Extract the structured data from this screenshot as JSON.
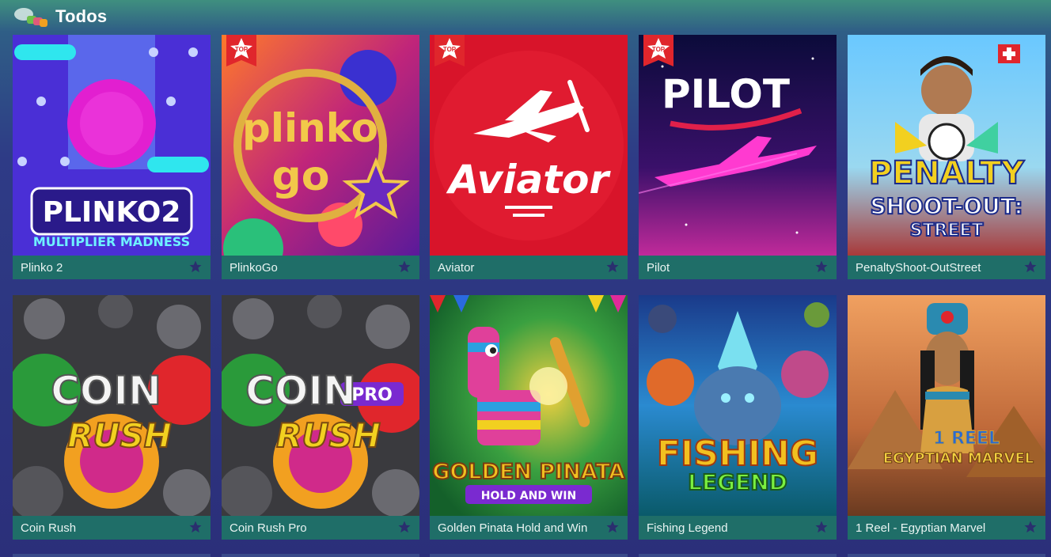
{
  "header": {
    "title": "Todos",
    "logo_icon": "categories-icon"
  },
  "badge_text": "TOP",
  "games": [
    {
      "name": "Plinko 2",
      "art_title": "PLINKO2",
      "art_subtitle": "MULTIPLIER MADNESS",
      "top": false
    },
    {
      "name": "PlinkoGo",
      "art_title": "plinko",
      "art_subtitle": "go",
      "top": true
    },
    {
      "name": "Aviator",
      "art_title": "Aviator",
      "top": true
    },
    {
      "name": "Pilot",
      "art_title": "PILOT",
      "top": true
    },
    {
      "name": "PenaltyShoot-OutStreet",
      "art_title": "PENALTY",
      "art_subtitle": "SHOOT-OUT:",
      "art_subtitle2": "STREET",
      "top": false
    },
    {
      "name": "Coin Rush",
      "art_title": "COIN",
      "art_subtitle": "RUSH",
      "top": false
    },
    {
      "name": "Coin Rush Pro",
      "art_title": "COIN",
      "art_subtitle": "RUSH",
      "art_badge": "PRO",
      "top": false
    },
    {
      "name": "Golden Pinata Hold and Win",
      "art_title": "GOLDEN PINATA",
      "art_subtitle": "HOLD AND WIN",
      "top": false
    },
    {
      "name": "Fishing Legend",
      "art_title": "FISHING",
      "art_subtitle": "LEGEND",
      "top": false
    },
    {
      "name": "1 Reel - Egyptian Marvel",
      "art_title": "1 REEL",
      "art_subtitle": "EGYPTIAN MARVEL",
      "top": false
    }
  ],
  "colors": {
    "card_bar": "#1f6e68",
    "star": "#2a2f6e",
    "badge": "#e0262c"
  },
  "icons": {
    "favorite": "star-icon"
  }
}
